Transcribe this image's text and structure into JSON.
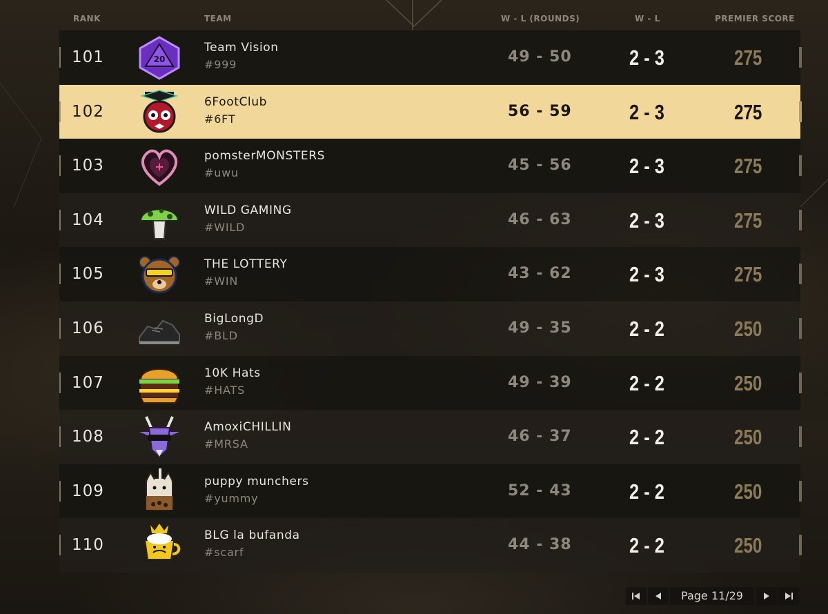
{
  "header": {
    "rank": "RANK",
    "team": "TEAM",
    "wl_rounds": "W - L (ROUNDS)",
    "wl": "W - L",
    "premier_score": "PREMIER SCORE"
  },
  "rows": [
    {
      "rank": "101",
      "name": "Team Vision",
      "tag": "#999",
      "wl_rounds": "49 - 50",
      "wl": "2 - 3",
      "score": "275",
      "logo": "purple-d20-dice-icon"
    },
    {
      "rank": "102",
      "name": "6FootClub",
      "tag": "#6FT",
      "wl_rounds": "56 - 59",
      "wl": "2 - 3",
      "score": "275",
      "logo": "graduate-owl-icon"
    },
    {
      "rank": "103",
      "name": "pomsterMONSTERS",
      "tag": "#uwu",
      "wl_rounds": "45 - 56",
      "wl": "2 - 3",
      "score": "275",
      "logo": "heart-icon"
    },
    {
      "rank": "104",
      "name": "WILD GAMING",
      "tag": "#WILD",
      "wl_rounds": "46 - 63",
      "wl": "2 - 3",
      "score": "275",
      "logo": "mushroom-icon"
    },
    {
      "rank": "105",
      "name": "THE LOTTERY",
      "tag": "#WIN",
      "wl_rounds": "43 - 62",
      "wl": "2 - 3",
      "score": "275",
      "logo": "bear-sunglasses-icon"
    },
    {
      "rank": "106",
      "name": "BigLongD",
      "tag": "#BLD",
      "wl_rounds": "49 - 35",
      "wl": "2 - 2",
      "score": "250",
      "logo": "sneaker-icon"
    },
    {
      "rank": "107",
      "name": "10K Hats",
      "tag": "#HATS",
      "wl_rounds": "49 - 39",
      "wl": "2 - 2",
      "score": "250",
      "logo": "burger-icon"
    },
    {
      "rank": "108",
      "name": "AmoxiCHILLIN",
      "tag": "#MRSA",
      "wl_rounds": "46 - 37",
      "wl": "2 - 2",
      "score": "250",
      "logo": "goat-sunglasses-icon"
    },
    {
      "rank": "109",
      "name": "puppy munchers",
      "tag": "#yummy",
      "wl_rounds": "52 - 43",
      "wl": "2 - 2",
      "score": "250",
      "logo": "bubble-tea-cat-icon"
    },
    {
      "rank": "110",
      "name": "BLG la bufanda",
      "tag": "#scarf",
      "wl_rounds": "44 - 38",
      "wl": "2 - 2",
      "score": "250",
      "logo": "crowned-teacup-icon"
    }
  ],
  "highlight_rank": "102",
  "pagination": {
    "label": "Page 11/29"
  },
  "colors": {
    "highlight_row": "#f1d89a",
    "score_text": "#8c7b58",
    "background": "#1c1812"
  }
}
